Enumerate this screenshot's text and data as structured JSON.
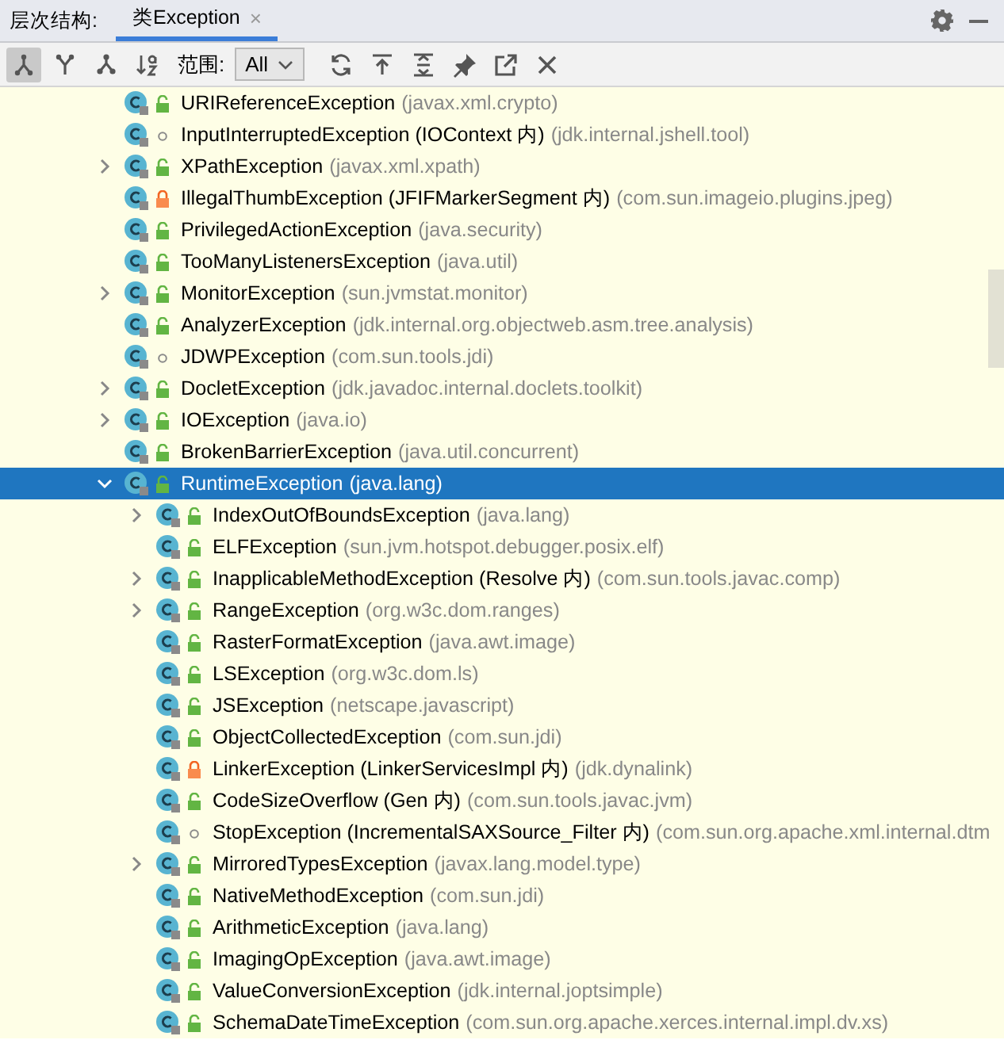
{
  "header": {
    "label": "层次结构:",
    "tabs": [
      {
        "title": "类Exception",
        "selected": true,
        "close": "×"
      }
    ]
  },
  "toolbar": {
    "buttons": [
      {
        "kind": "subtypes",
        "selected": true
      },
      {
        "kind": "supertypes",
        "selected": false
      },
      {
        "kind": "hierarchy",
        "selected": false
      },
      {
        "kind": "sort",
        "selected": false
      }
    ],
    "scope_label": "范围:",
    "scope_value": "All",
    "actions": [
      {
        "kind": "refresh"
      },
      {
        "kind": "export"
      },
      {
        "kind": "expand"
      },
      {
        "kind": "pin"
      },
      {
        "kind": "open"
      },
      {
        "kind": "close"
      }
    ]
  },
  "tree": {
    "items": [
      {
        "name": "URIReferenceException",
        "package": "(javax.xml.crypto)",
        "kind": "public",
        "selected": false
      },
      {
        "name": "InputInterruptedException (IOContext 内)",
        "package": "(jdk.internal.jshell.tool)",
        "kind": "package",
        "selected": false
      },
      {
        "name": "XPathException",
        "package": "(javax.xml.xpath)",
        "kind": "public",
        "expanded": false,
        "selected": false
      },
      {
        "name": "IllegalThumbException (JFIFMarkerSegment 内)",
        "package": "(com.sun.imageio.plugins.jpeg)",
        "kind": "private",
        "selected": false
      },
      {
        "name": "PrivilegedActionException",
        "package": "(java.security)",
        "kind": "public",
        "selected": false
      },
      {
        "name": "TooManyListenersException",
        "package": "(java.util)",
        "kind": "public",
        "selected": false
      },
      {
        "name": "MonitorException",
        "package": "(sun.jvmstat.monitor)",
        "kind": "public",
        "expanded": false,
        "selected": false
      },
      {
        "name": "AnalyzerException",
        "package": "(jdk.internal.org.objectweb.asm.tree.analysis)",
        "kind": "public",
        "selected": false
      },
      {
        "name": "JDWPException",
        "package": "(com.sun.tools.jdi)",
        "kind": "package",
        "selected": false
      },
      {
        "name": "DocletException",
        "package": "(jdk.javadoc.internal.doclets.toolkit)",
        "kind": "public",
        "expanded": false,
        "selected": false
      },
      {
        "name": "IOException",
        "package": "(java.io)",
        "kind": "public",
        "expanded": false,
        "selected": false
      },
      {
        "name": "BrokenBarrierException",
        "package": "(java.util.concurrent)",
        "kind": "public",
        "selected": false
      },
      {
        "name": "RuntimeException",
        "package": "(java.lang)",
        "kind": "public",
        "expanded": true,
        "selected": true,
        "children": [
          {
            "name": "IndexOutOfBoundsException",
            "package": "(java.lang)",
            "kind": "public",
            "expanded": false,
            "selected": false
          },
          {
            "name": "ELFException",
            "package": "(sun.jvm.hotspot.debugger.posix.elf)",
            "kind": "public",
            "selected": false
          },
          {
            "name": "InapplicableMethodException (Resolve 内)",
            "package": "(com.sun.tools.javac.comp)",
            "kind": "public",
            "expanded": false,
            "selected": false
          },
          {
            "name": "RangeException",
            "package": "(org.w3c.dom.ranges)",
            "kind": "public",
            "expanded": false,
            "selected": false
          },
          {
            "name": "RasterFormatException",
            "package": "(java.awt.image)",
            "kind": "public",
            "selected": false
          },
          {
            "name": "LSException",
            "package": "(org.w3c.dom.ls)",
            "kind": "public",
            "selected": false
          },
          {
            "name": "JSException",
            "package": "(netscape.javascript)",
            "kind": "public",
            "selected": false
          },
          {
            "name": "ObjectCollectedException",
            "package": "(com.sun.jdi)",
            "kind": "public",
            "selected": false
          },
          {
            "name": "LinkerException (LinkerServicesImpl 内)",
            "package": "(jdk.dynalink)",
            "kind": "private",
            "selected": false
          },
          {
            "name": "CodeSizeOverflow (Gen 内)",
            "package": "(com.sun.tools.javac.jvm)",
            "kind": "public",
            "selected": false
          },
          {
            "name": "StopException (IncrementalSAXSource_Filter 内)",
            "package": "(com.sun.org.apache.xml.internal.dtm",
            "kind": "package",
            "selected": false
          },
          {
            "name": "MirroredTypesException",
            "package": "(javax.lang.model.type)",
            "kind": "public",
            "expanded": false,
            "selected": false
          },
          {
            "name": "NativeMethodException",
            "package": "(com.sun.jdi)",
            "kind": "public",
            "selected": false
          },
          {
            "name": "ArithmeticException",
            "package": "(java.lang)",
            "kind": "public",
            "selected": false
          },
          {
            "name": "ImagingOpException",
            "package": "(java.awt.image)",
            "kind": "public",
            "selected": false
          },
          {
            "name": "ValueConversionException",
            "package": "(jdk.internal.joptsimple)",
            "kind": "public",
            "selected": false
          },
          {
            "name": "SchemaDateTimeException",
            "package": "(com.sun.org.apache.xerces.internal.impl.dv.xs)",
            "kind": "public",
            "selected": false
          }
        ]
      }
    ]
  }
}
